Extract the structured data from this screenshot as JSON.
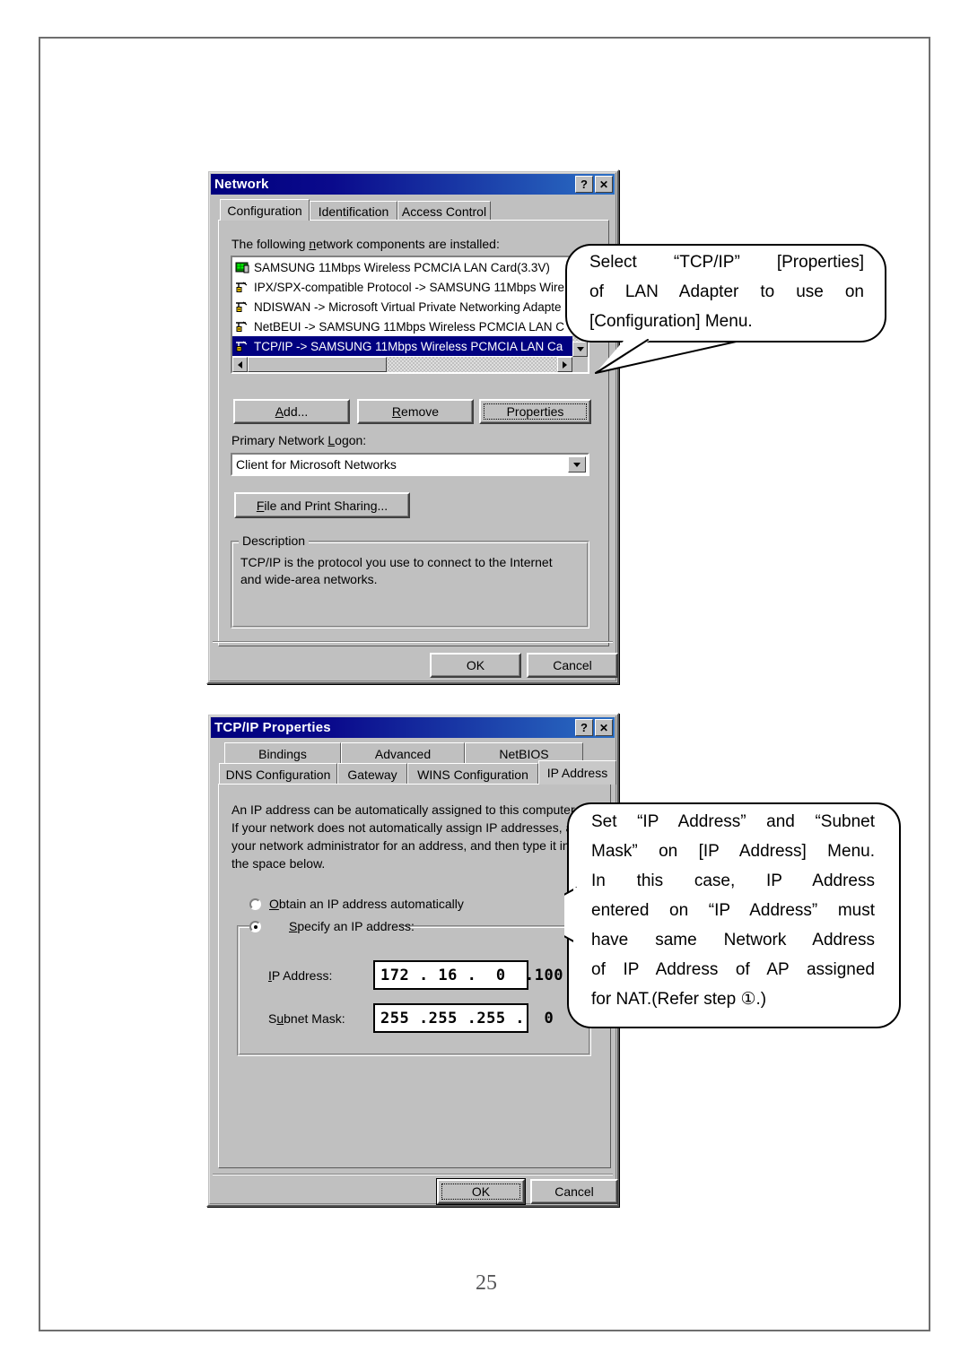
{
  "page": {
    "number": "25"
  },
  "network_dialog": {
    "title": "Network",
    "help_button": "?",
    "close_button": "✕",
    "tabs": [
      {
        "label": "Configuration",
        "selected": true
      },
      {
        "label": "Identification",
        "selected": false
      },
      {
        "label": "Access Control",
        "selected": false
      }
    ],
    "list_label_pre": "The following ",
    "list_label_key": "n",
    "list_label_post": "etwork components are installed:",
    "components": [
      {
        "icon": "network-adapter-icon",
        "label": "SAMSUNG 11Mbps Wireless PCMCIA LAN Card(3.3V)",
        "selected": false
      },
      {
        "icon": "protocol-icon",
        "label": "IPX/SPX-compatible Protocol -> SAMSUNG 11Mbps Wire",
        "selected": false
      },
      {
        "icon": "protocol-icon",
        "label": "NDISWAN -> Microsoft Virtual Private Networking Adapte",
        "selected": false
      },
      {
        "icon": "protocol-icon",
        "label": "NetBEUI -> SAMSUNG 11Mbps Wireless PCMCIA LAN C",
        "selected": false
      },
      {
        "icon": "protocol-icon",
        "label": "TCP/IP -> SAMSUNG 11Mbps Wireless PCMCIA LAN Ca",
        "selected": true
      }
    ],
    "buttons": {
      "add": "Add...",
      "remove": "Remove",
      "properties": "Properties"
    },
    "primary_logon_label_pre": "Primary Network ",
    "primary_logon_label_key": "L",
    "primary_logon_label_post": "ogon:",
    "primary_logon_value": "Client for Microsoft Networks",
    "file_print_sharing": "File and Print Sharing...",
    "description_group_title": "Description",
    "description_text": "TCP/IP is the protocol you use to connect to the Internet and wide-area networks.",
    "ok": "OK",
    "cancel": "Cancel"
  },
  "tcpip_dialog": {
    "title": "TCP/IP Properties",
    "help_button": "?",
    "close_button": "✕",
    "tabs_row1": [
      {
        "label": "Bindings",
        "selected": false
      },
      {
        "label": "Advanced",
        "selected": false
      },
      {
        "label": "NetBIOS",
        "selected": false
      }
    ],
    "tabs_row2": [
      {
        "label": "DNS Configuration",
        "selected": false
      },
      {
        "label": "Gateway",
        "selected": false
      },
      {
        "label": "WINS Configuration",
        "selected": false
      },
      {
        "label": "IP Address",
        "selected": true
      }
    ],
    "intro_text": "An IP address can be automatically assigned to this computer. If your network does not automatically assign IP addresses, ask your network administrator for an address, and then type it in the space below.",
    "radio_obtain": "Obtain an IP address automatically",
    "radio_obtain_selected": false,
    "radio_specify": "Specify an IP address:",
    "radio_specify_selected": true,
    "ip_address_label": "IP Address:",
    "ip_address_value": "172 . 16 .  0  .100",
    "subnet_mask_label": "Subnet Mask:",
    "subnet_mask_value": "255 .255 .255 .  0",
    "ok": "OK",
    "cancel": "Cancel"
  },
  "callouts": {
    "first": {
      "lines": [
        "Select  “TCP/IP” [Properties]",
        "of LAN Adapter to use on",
        "[Configuration] Menu."
      ]
    },
    "second": {
      "lines": [
        "Set “IP Address” and “Subnet",
        "Mask” on [IP Address] Menu.",
        "In this case, IP Address",
        "entered on “IP Address” must",
        "have same Network Address",
        "of IP Address of AP assigned",
        "for NAT.(Refer step ①.)"
      ]
    }
  },
  "colors": {
    "titlebar_start": "#00007e",
    "titlebar_end": "#2b6fc4",
    "dialog_face": "#c0c0c0",
    "selection": "#000080",
    "page_border": "#6e6e6e"
  }
}
